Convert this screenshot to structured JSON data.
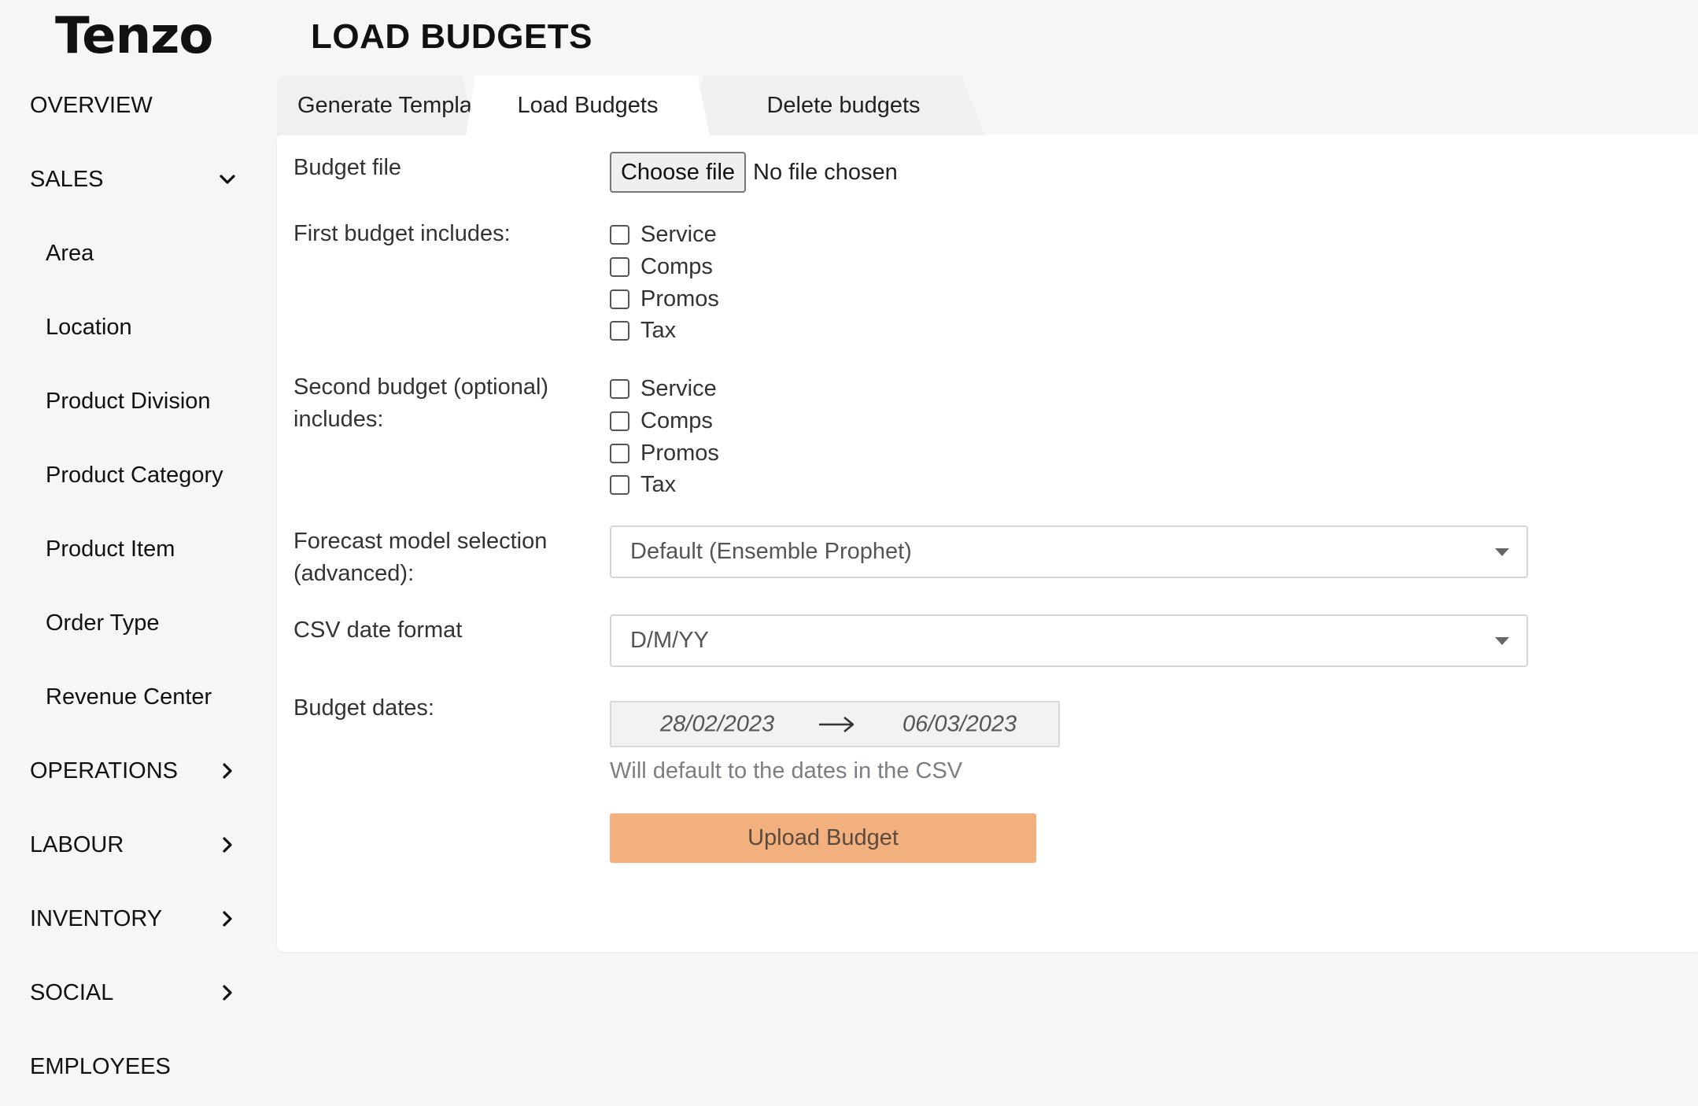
{
  "app": {
    "logo_text": "Tenzo",
    "page_title": "LOAD BUDGETS"
  },
  "sidebar": {
    "items": [
      {
        "label": "OVERVIEW",
        "level": "top",
        "chevron": "none"
      },
      {
        "label": "SALES",
        "level": "top",
        "chevron": "down"
      },
      {
        "label": "Area",
        "level": "sub",
        "chevron": "none"
      },
      {
        "label": "Location",
        "level": "sub",
        "chevron": "none"
      },
      {
        "label": "Product Division",
        "level": "sub",
        "chevron": "none"
      },
      {
        "label": "Product Category",
        "level": "sub",
        "chevron": "none"
      },
      {
        "label": "Product Item",
        "level": "sub",
        "chevron": "none"
      },
      {
        "label": "Order Type",
        "level": "sub",
        "chevron": "none"
      },
      {
        "label": "Revenue Center",
        "level": "sub",
        "chevron": "none"
      },
      {
        "label": "OPERATIONS",
        "level": "top",
        "chevron": "right"
      },
      {
        "label": "LABOUR",
        "level": "top",
        "chevron": "right"
      },
      {
        "label": "INVENTORY",
        "level": "top",
        "chevron": "right"
      },
      {
        "label": "SOCIAL",
        "level": "top",
        "chevron": "right"
      },
      {
        "label": "EMPLOYEES",
        "level": "top",
        "chevron": "none"
      }
    ]
  },
  "tabs": [
    {
      "label": "Generate Template",
      "active": false
    },
    {
      "label": "Load Budgets",
      "active": true
    },
    {
      "label": "Delete budgets",
      "active": false
    }
  ],
  "form": {
    "budget_file_label": "Budget file",
    "choose_file_label": "Choose file",
    "file_status": "No file chosen",
    "first_budget_label": "First budget includes:",
    "first_budget_options": [
      "Service",
      "Comps",
      "Promos",
      "Tax"
    ],
    "second_budget_label_line1": "Second budget (optional)",
    "second_budget_label_line2": "includes:",
    "second_budget_options": [
      "Service",
      "Comps",
      "Promos",
      "Tax"
    ],
    "forecast_label_line1": "Forecast model selection",
    "forecast_label_line2": "(advanced):",
    "forecast_selected": "Default (Ensemble Prophet)",
    "csv_date_label": "CSV date format",
    "csv_date_selected": "D/M/YY",
    "budget_dates_label": "Budget dates:",
    "date_start": "28/02/2023",
    "date_end": "06/03/2023",
    "date_hint": "Will default to the dates in the CSV",
    "upload_label": "Upload Budget"
  },
  "colors": {
    "upload_button": "#f3b07f",
    "card_background": "#ffffff",
    "page_background": "#f7f6f6"
  }
}
